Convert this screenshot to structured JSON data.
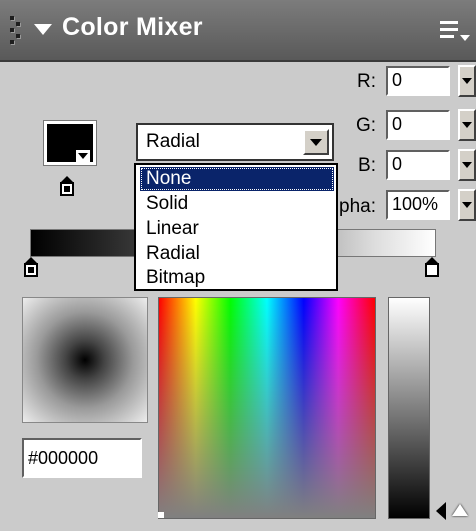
{
  "panel": {
    "title": "Color Mixer",
    "icons": [
      "grip-icon",
      "collapse-arrow-icon",
      "panel-menu-icon"
    ]
  },
  "fill": {
    "type_selected": "Radial",
    "options": [
      "None",
      "Solid",
      "Linear",
      "Radial",
      "Bitmap"
    ],
    "highlighted_option": "None"
  },
  "rgb": {
    "r_label": "R:",
    "r_value": "0",
    "g_label": "G:",
    "g_value": "0",
    "b_label": "B:",
    "b_value": "0",
    "alpha_label": "pha:",
    "alpha_value": "100%"
  },
  "hex": {
    "value": "#000000"
  },
  "colors": {
    "swatch": "#000000",
    "highlight": "#0a246a",
    "panel_bg": "#cbcbcb"
  }
}
